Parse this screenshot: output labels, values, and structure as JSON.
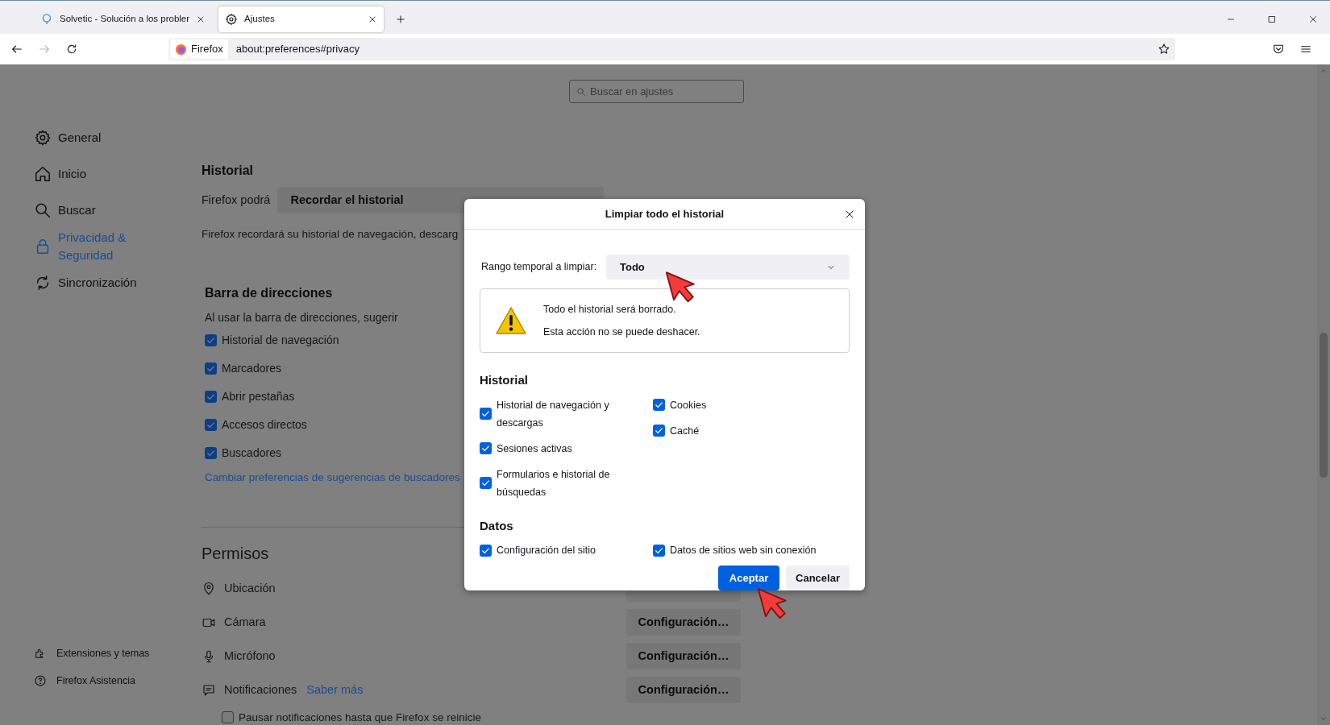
{
  "browser": {
    "tabs": [
      {
        "title": "Solvetic - Solución a los probler",
        "selected": false
      },
      {
        "title": "Ajustes",
        "selected": true
      }
    ],
    "identity": "Firefox",
    "url": "about:preferences#privacy"
  },
  "settings": {
    "search_placeholder": "Buscar en ajustes",
    "sidebar": {
      "items": [
        {
          "label": "General",
          "selected": false
        },
        {
          "label": "Inicio",
          "selected": false
        },
        {
          "label": "Buscar",
          "selected": false
        },
        {
          "label": "Privacidad & Seguridad",
          "selected": true
        },
        {
          "label": "Sincronización",
          "selected": false
        }
      ],
      "footer": [
        "Extensiones y temas",
        "Firefox Asistencia"
      ]
    },
    "history": {
      "heading": "Historial",
      "mode_label": "Firefox podrá",
      "mode_value": "Recordar el historial",
      "description": "Firefox recordará su historial de navegación, descarg"
    },
    "address_bar": {
      "heading": "Barra de direcciones",
      "intro": "Al usar la barra de direcciones, sugerir",
      "options": [
        {
          "label": "Historial de navegación",
          "checked": true
        },
        {
          "label": "Marcadores",
          "checked": true
        },
        {
          "label": "Abrir pestañas",
          "checked": true
        },
        {
          "label": "Accesos directos",
          "checked": true
        },
        {
          "label": "Buscadores",
          "checked": true
        }
      ],
      "link": "Cambiar preferencias de sugerencias de buscadores"
    },
    "permissions": {
      "heading": "Permisos",
      "items": [
        {
          "label": "Ubicación"
        },
        {
          "label": "Cámara",
          "button": "Configuración…"
        },
        {
          "label": "Micrófono",
          "button": "Configuración…"
        },
        {
          "label": "Notificaciones",
          "link": "Saber más",
          "button": "Configuración…"
        }
      ],
      "pause": {
        "label": "Pausar notificaciones hasta que Firefox se reinicie",
        "checked": false
      }
    }
  },
  "dialog": {
    "title": "Limpiar todo el historial",
    "range_label": "Rango temporal a limpiar:",
    "range_value": "Todo",
    "warning": [
      "Todo el historial será borrado.",
      "Esta acción no se puede deshacer."
    ],
    "sections": [
      {
        "heading": "Historial",
        "columns": [
          [
            {
              "label": "Historial de navegación y descargas",
              "checked": true
            },
            {
              "label": "Sesiones activas",
              "checked": true
            },
            {
              "label": "Formularios e historial de búsquedas",
              "checked": true
            }
          ],
          [
            {
              "label": "Cookies",
              "checked": true
            },
            {
              "label": "Caché",
              "checked": true
            }
          ]
        ]
      },
      {
        "heading": "Datos",
        "columns": [
          [
            {
              "label": "Configuración del sitio",
              "checked": true
            }
          ],
          [
            {
              "label": "Datos de sitios web sin conexión",
              "checked": true
            }
          ]
        ]
      }
    ],
    "buttons": [
      {
        "label": "Aceptar",
        "kind": "primary"
      },
      {
        "label": "Cancelar",
        "kind": "secondary"
      }
    ]
  }
}
